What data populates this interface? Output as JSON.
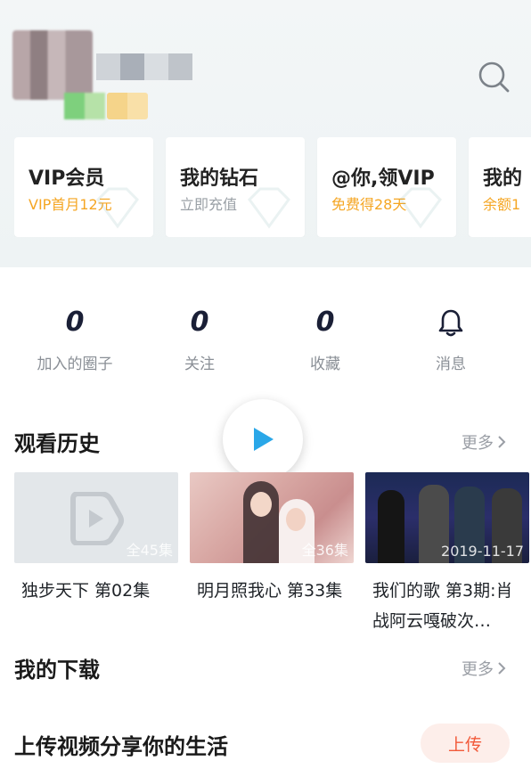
{
  "colors": {
    "accent_orange": "#f5a623",
    "accent_red": "#f25a3a",
    "play_blue": "#2aa7e8"
  },
  "header": {
    "search_icon": "search-icon"
  },
  "member_cards": [
    {
      "title": "VIP会员",
      "subtitle": "VIP首月12元",
      "subtitle_color": "#f5a623"
    },
    {
      "title": "我的钻石",
      "subtitle": "立即充值",
      "subtitle_color": "#9aa0a6"
    },
    {
      "title": "@你,领VIP",
      "subtitle": "免费得28天",
      "subtitle_color": "#f5a623"
    },
    {
      "title": "我的",
      "subtitle": "余额1",
      "subtitle_color": "#f5a623"
    }
  ],
  "stats": [
    {
      "value": "0",
      "label": "加入的圈子"
    },
    {
      "value": "0",
      "label": "关注"
    },
    {
      "value": "0",
      "label": "收藏"
    },
    {
      "icon": "bell-icon",
      "label": "消息"
    }
  ],
  "history": {
    "title": "观看历史",
    "more": "更多",
    "items": [
      {
        "title": "独步天下 第02集",
        "tag": "全45集"
      },
      {
        "title": "明月照我心 第33集",
        "tag": "全36集"
      },
      {
        "title": "我们的歌 第3期:肖战阿云嘎破次…",
        "tag": "2019-11-17"
      }
    ]
  },
  "downloads": {
    "title": "我的下载",
    "more": "更多"
  },
  "upload": {
    "title": "上传视频分享你的生活",
    "button": "上传"
  }
}
